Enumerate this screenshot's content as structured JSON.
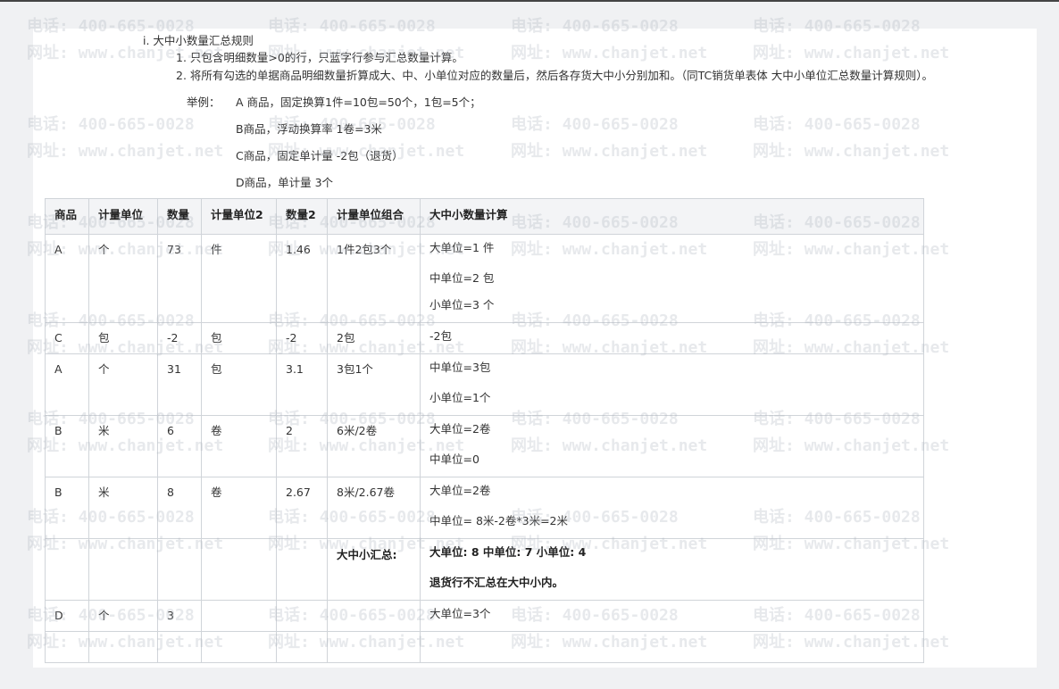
{
  "rules": {
    "heading": "i.  大中小数量汇总规则",
    "rule1": "1. 只包含明细数量>0的行，只蓝字行参与汇总数量计算。",
    "rule2": "2. 将所有勾选的单据商品明细数量折算成大、中、小单位对应的数量后，然后各存货大中小分别加和。（同TC销货单表体 大中小单位汇总数量计算规则）。",
    "example_label": "举例：",
    "examples": [
      "A 商品，固定换算1件=10包=50个，1包=5个；",
      "B商品，浮动换算率 1卷=3米",
      "C商品，固定单计量   -2包（退货）",
      "D商品，单计量   3个"
    ]
  },
  "table": {
    "headers": [
      "商品",
      "计量单位",
      "数量",
      "计量单位2",
      "数量2",
      "计量单位组合",
      "大中小数量计算"
    ],
    "rows": [
      [
        "A",
        "个",
        "73",
        "件",
        "1.46",
        "1件2包3个",
        [
          "大单位=1 件",
          "中单位=2 包",
          "小单位=3 个"
        ]
      ],
      [
        "C",
        "包",
        "-2",
        "包",
        "-2",
        "2包",
        [
          "-2包"
        ]
      ],
      [
        "A",
        "个",
        "31",
        "包",
        "3.1",
        "3包1个",
        [
          "中单位=3包",
          "小单位=1个"
        ]
      ],
      [
        "B",
        "米",
        "6",
        "卷",
        "2",
        "6米/2卷",
        [
          "大单位=2卷",
          "中单位=0"
        ]
      ],
      [
        "B",
        "米",
        "8",
        "卷",
        "2.67",
        "8米/2.67卷",
        [
          "大单位=2卷",
          "中单位= 8米-2卷*3米=2米"
        ]
      ],
      [
        "",
        "",
        "",
        "",
        "",
        "大中小汇总:",
        [
          "大单位:  8  中单位:  7  小单位:  4",
          "退货行不汇总在大中小内。"
        ]
      ],
      [
        "D",
        "个",
        "3",
        "",
        "",
        "",
        [
          "大单位=3个"
        ]
      ],
      [
        "",
        "",
        "",
        "",
        "",
        "",
        []
      ]
    ]
  },
  "watermark": {
    "phone": "电话: 400-665-0028",
    "site": "网址: www.chanjet.net"
  }
}
